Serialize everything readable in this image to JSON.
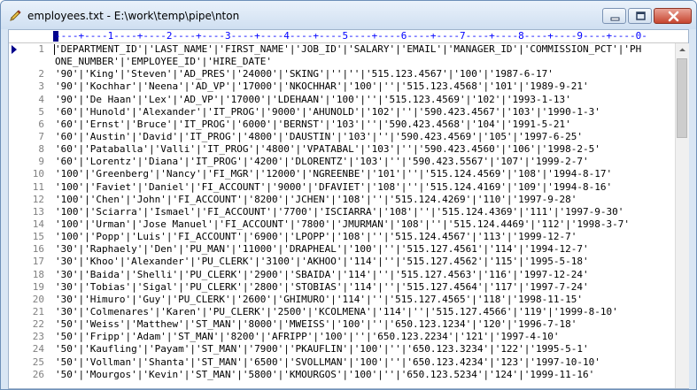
{
  "window": {
    "title": "employees.txt - E:\\work\\temp\\pipe\\nton"
  },
  "ruler": {
    "text": "----+----1----+----2----+----3----+----4----+----5----+----6----+----7----+----8----+----9----+----0-"
  },
  "lines": [
    {
      "num": "1",
      "text": "'DEPARTMENT_ID'|'LAST_NAME'|'FIRST_NAME'|'JOB_ID'|'SALARY'|'EMAIL'|'MANAGER_ID'|'COMMISSION_PCT'|'PH"
    },
    {
      "num": "",
      "text": "ONE_NUMBER'|'EMPLOYEE_ID'|'HIRE_DATE'"
    },
    {
      "num": "2",
      "text": "'90'|'King'|'Steven'|'AD_PRES'|'24000'|'SKING'|''|''|'515.123.4567'|'100'|'1987-6-17'"
    },
    {
      "num": "3",
      "text": "'90'|'Kochhar'|'Neena'|'AD_VP'|'17000'|'NKOCHHAR'|'100'|''|'515.123.4568'|'101'|'1989-9-21'"
    },
    {
      "num": "4",
      "text": "'90'|'De Haan'|'Lex'|'AD_VP'|'17000'|'LDEHAAN'|'100'|''|'515.123.4569'|'102'|'1993-1-13'"
    },
    {
      "num": "5",
      "text": "'60'|'Hunold'|'Alexander'|'IT_PROG'|'9000'|'AHUNOLD'|'102'|''|'590.423.4567'|'103'|'1990-1-3'"
    },
    {
      "num": "6",
      "text": "'60'|'Ernst'|'Bruce'|'IT_PROG'|'6000'|'BERNST'|'103'|''|'590.423.4568'|'104'|'1991-5-21'"
    },
    {
      "num": "7",
      "text": "'60'|'Austin'|'David'|'IT_PROG'|'4800'|'DAUSTIN'|'103'|''|'590.423.4569'|'105'|'1997-6-25'"
    },
    {
      "num": "8",
      "text": "'60'|'Pataballa'|'Valli'|'IT_PROG'|'4800'|'VPATABAL'|'103'|''|'590.423.4560'|'106'|'1998-2-5'"
    },
    {
      "num": "9",
      "text": "'60'|'Lorentz'|'Diana'|'IT_PROG'|'4200'|'DLORENTZ'|'103'|''|'590.423.5567'|'107'|'1999-2-7'"
    },
    {
      "num": "10",
      "text": "'100'|'Greenberg'|'Nancy'|'FI_MGR'|'12000'|'NGREENBE'|'101'|''|'515.124.4569'|'108'|'1994-8-17'"
    },
    {
      "num": "11",
      "text": "'100'|'Faviet'|'Daniel'|'FI_ACCOUNT'|'9000'|'DFAVIET'|'108'|''|'515.124.4169'|'109'|'1994-8-16'"
    },
    {
      "num": "12",
      "text": "'100'|'Chen'|'John'|'FI_ACCOUNT'|'8200'|'JCHEN'|'108'|''|'515.124.4269'|'110'|'1997-9-28'"
    },
    {
      "num": "13",
      "text": "'100'|'Sciarra'|'Ismael'|'FI_ACCOUNT'|'7700'|'ISCIARRA'|'108'|''|'515.124.4369'|'111'|'1997-9-30'"
    },
    {
      "num": "14",
      "text": "'100'|'Urman'|'Jose Manuel'|'FI_ACCOUNT'|'7800'|'JMURMAN'|'108'|''|'515.124.4469'|'112'|'1998-3-7'"
    },
    {
      "num": "15",
      "text": "'100'|'Popp'|'Luis'|'FI_ACCOUNT'|'6900'|'LPOPP'|'108'|''|'515.124.4567'|'113'|'1999-12-7'"
    },
    {
      "num": "16",
      "text": "'30'|'Raphaely'|'Den'|'PU_MAN'|'11000'|'DRAPHEAL'|'100'|''|'515.127.4561'|'114'|'1994-12-7'"
    },
    {
      "num": "17",
      "text": "'30'|'Khoo'|'Alexander'|'PU_CLERK'|'3100'|'AKHOO'|'114'|''|'515.127.4562'|'115'|'1995-5-18'"
    },
    {
      "num": "18",
      "text": "'30'|'Baida'|'Shelli'|'PU_CLERK'|'2900'|'SBAIDA'|'114'|''|'515.127.4563'|'116'|'1997-12-24'"
    },
    {
      "num": "19",
      "text": "'30'|'Tobias'|'Sigal'|'PU_CLERK'|'2800'|'STOBIAS'|'114'|''|'515.127.4564'|'117'|'1997-7-24'"
    },
    {
      "num": "20",
      "text": "'30'|'Himuro'|'Guy'|'PU_CLERK'|'2600'|'GHIMURO'|'114'|''|'515.127.4565'|'118'|'1998-11-15'"
    },
    {
      "num": "21",
      "text": "'30'|'Colmenares'|'Karen'|'PU_CLERK'|'2500'|'KCOLMENA'|'114'|''|'515.127.4566'|'119'|'1999-8-10'"
    },
    {
      "num": "22",
      "text": "'50'|'Weiss'|'Matthew'|'ST_MAN'|'8000'|'MWEISS'|'100'|''|'650.123.1234'|'120'|'1996-7-18'"
    },
    {
      "num": "23",
      "text": "'50'|'Fripp'|'Adam'|'ST_MAN'|'8200'|'AFRIPP'|'100'|''|'650.123.2234'|'121'|'1997-4-10'"
    },
    {
      "num": "24",
      "text": "'50'|'Kaufling'|'Payam'|'ST_MAN'|'7900'|'PKAUFLIN'|'100'|''|'650.123.3234'|'122'|'1995-5-1'"
    },
    {
      "num": "25",
      "text": "'50'|'Vollman'|'Shanta'|'ST_MAN'|'6500'|'SVOLLMAN'|'100'|''|'650.123.4234'|'123'|'1997-10-10'"
    },
    {
      "num": "26",
      "text": "'50'|'Mourgos'|'Kevin'|'ST_MAN'|'5800'|'KMOURGOS'|'100'|''|'650.123.5234'|'124'|'1999-11-16'"
    }
  ]
}
